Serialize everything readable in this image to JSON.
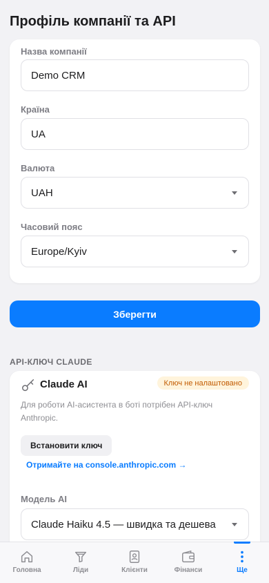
{
  "page": {
    "title": "Профіль компанії та API"
  },
  "profile": {
    "company_label": "Назва компанії",
    "company_value": "Demo CRM",
    "country_label": "Країна",
    "country_value": "UA",
    "currency_label": "Валюта",
    "currency_value": "UAH",
    "timezone_label": "Часовий пояс",
    "timezone_value": "Europe/Kyiv"
  },
  "save_label": "Зберегти",
  "api": {
    "section_header": "API-КЛЮЧ CLAUDE",
    "title": "Claude AI",
    "status_badge": "Ключ не налаштовано",
    "description": "Для роботи AI-асистента в боті потрібен API-ключ Anthropic.",
    "set_key_label": "Встановити ключ",
    "get_key_link": "Отримайте на console.anthropic.com →",
    "model_label": "Модель AI",
    "model_value": "Claude Haiku 4.5 — швидка та дешева"
  },
  "tabs": [
    {
      "label": "Головна",
      "icon": "home-icon",
      "active": false
    },
    {
      "label": "Ліди",
      "icon": "funnel-icon",
      "active": false
    },
    {
      "label": "Клієнти",
      "icon": "contacts-icon",
      "active": false
    },
    {
      "label": "Фінанси",
      "icon": "wallet-icon",
      "active": false
    },
    {
      "label": "Ще",
      "icon": "more-icon",
      "active": true
    }
  ],
  "colors": {
    "accent": "#0a7cff",
    "badge_bg": "#fff4dc",
    "badge_text": "#c15a00"
  }
}
